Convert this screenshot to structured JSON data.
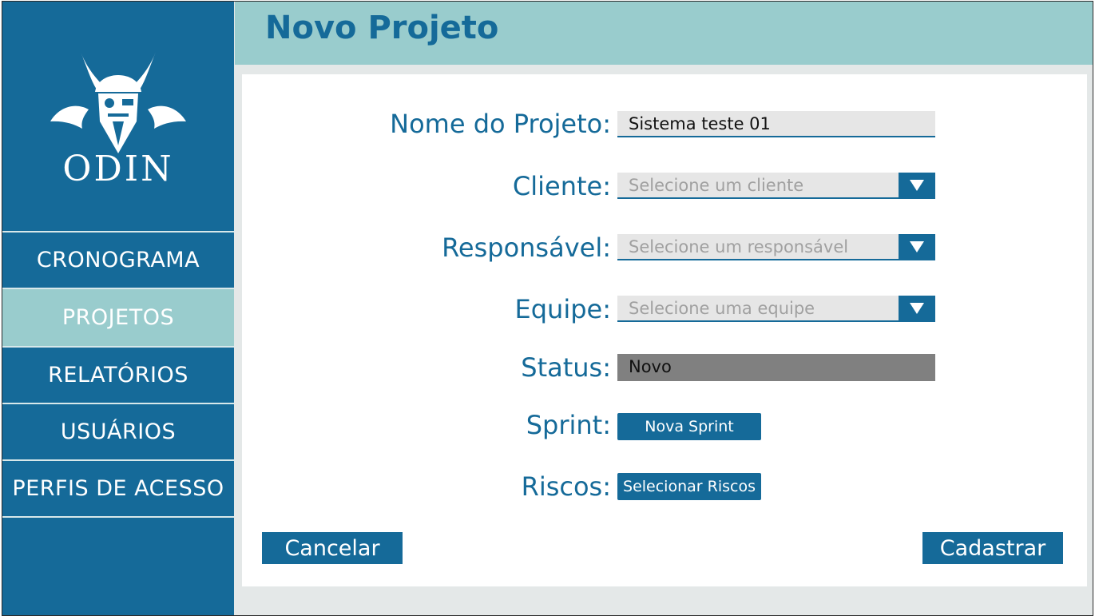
{
  "sidebar": {
    "logo_text": "ODIN",
    "items": [
      {
        "label": "CRONOGRAMA"
      },
      {
        "label": "PROJETOS"
      },
      {
        "label": "RELATÓRIOS"
      },
      {
        "label": "USUÁRIOS"
      },
      {
        "label": "PERFIS DE ACESSO"
      }
    ],
    "active_item": "PROJETOS"
  },
  "header": {
    "title": "Novo Projeto"
  },
  "form": {
    "project_name": {
      "label": "Nome do Projeto:",
      "value": "Sistema teste 01"
    },
    "client": {
      "label": "Cliente:",
      "placeholder": "Selecione um cliente"
    },
    "responsible": {
      "label": "Responsável:",
      "placeholder": "Selecione um responsável"
    },
    "team": {
      "label": "Equipe:",
      "placeholder": "Selecione uma equipe"
    },
    "status": {
      "label": "Status:",
      "value": "Novo"
    },
    "sprint": {
      "label": "Sprint:",
      "button": "Nova Sprint"
    },
    "risks": {
      "label": "Riscos:",
      "button": "Selecionar Riscos"
    }
  },
  "actions": {
    "cancel": "Cancelar",
    "submit": "Cadastrar"
  },
  "icons": {
    "logo": "viking-helmet-icon",
    "dropdown": "triangle-down-icon"
  },
  "colors": {
    "primary": "#156a99",
    "accent": "#99cccd",
    "status_bg": "#808080",
    "field_bg": "#e6e6e6"
  }
}
